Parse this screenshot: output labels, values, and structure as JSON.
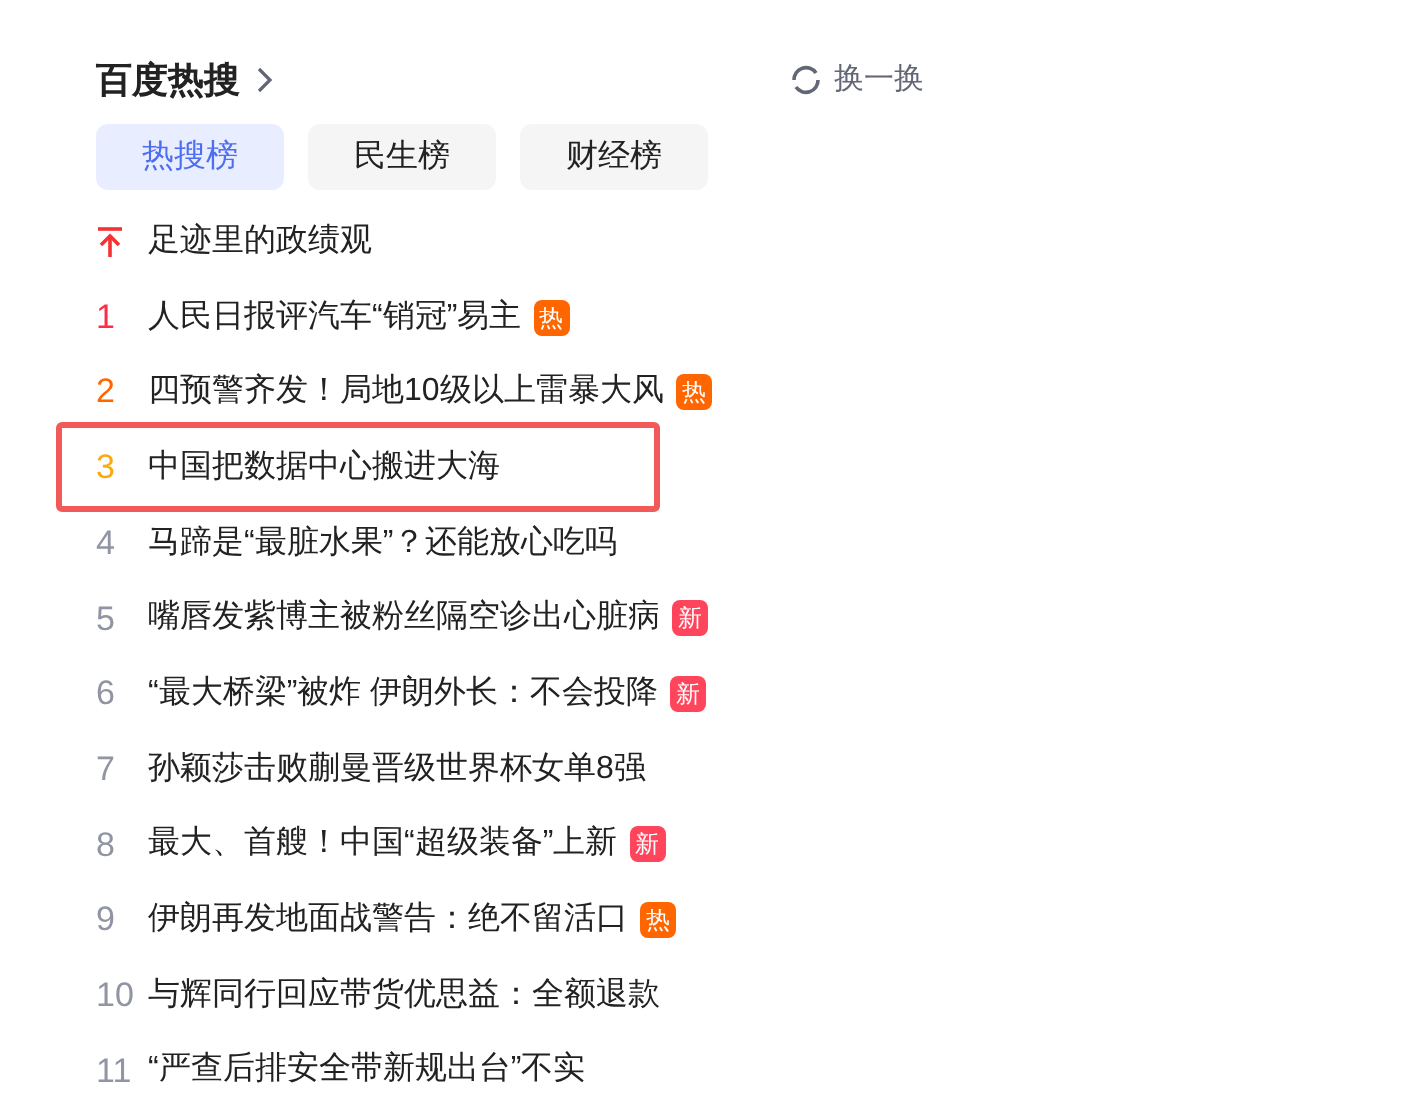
{
  "header": {
    "title": "百度热搜",
    "refresh": "换一换"
  },
  "tabs": [
    {
      "label": "热搜榜",
      "selected": true
    },
    {
      "label": "民生榜",
      "selected": false
    },
    {
      "label": "财经榜",
      "selected": false
    }
  ],
  "items": [
    {
      "kind": "pinned",
      "title": "足迹里的政绩观",
      "color": "#f73131",
      "highlighted": false
    },
    {
      "kind": "ranked",
      "rank": "1",
      "title": "人民日报评汽车“销冠”易主",
      "color": "#fe2d46",
      "badge": {
        "kind": "hot",
        "label": "热"
      },
      "highlighted": false
    },
    {
      "kind": "ranked",
      "rank": "2",
      "title": "四预警齐发！局地10级以上雷暴大风",
      "color": "#ff6600",
      "badge": {
        "kind": "hot",
        "label": "热"
      },
      "highlighted": false
    },
    {
      "kind": "ranked",
      "rank": "3",
      "title": "中国把数据中心搬进大海",
      "color": "#faa90e",
      "highlighted": true
    },
    {
      "kind": "ranked",
      "rank": "4",
      "title": "马蹄是“最脏水果”？还能放心吃吗",
      "color": "#9195a3",
      "highlighted": false
    },
    {
      "kind": "ranked",
      "rank": "5",
      "title": "嘴唇发紫博主被粉丝隔空诊出心脏病",
      "color": "#9195a3",
      "badge": {
        "kind": "new",
        "label": "新"
      },
      "highlighted": false
    },
    {
      "kind": "ranked",
      "rank": "6",
      "title": "“最大桥梁”被炸 伊朗外长：不会投降",
      "color": "#9195a3",
      "badge": {
        "kind": "new",
        "label": "新"
      },
      "highlighted": false
    },
    {
      "kind": "ranked",
      "rank": "7",
      "title": "孙颖莎击败蒯曼晋级世界杯女单8强",
      "color": "#9195a3",
      "highlighted": false
    },
    {
      "kind": "ranked",
      "rank": "8",
      "title": "最大、首艘！中国“超级装备”上新",
      "color": "#9195a3",
      "badge": {
        "kind": "new",
        "label": "新"
      },
      "highlighted": false
    },
    {
      "kind": "ranked",
      "rank": "9",
      "title": "伊朗再发地面战警告：绝不留活口",
      "color": "#9195a3",
      "badge": {
        "kind": "hot",
        "label": "热"
      },
      "highlighted": false
    },
    {
      "kind": "ranked",
      "rank": "10",
      "title": "与辉同行回应带货优思益：全额退款",
      "color": "#9195a3",
      "highlighted": false
    },
    {
      "kind": "ranked",
      "rank": "11",
      "title": "“严查后排安全带新规出台”不实",
      "color": "#9195a3",
      "highlighted": false
    }
  ]
}
